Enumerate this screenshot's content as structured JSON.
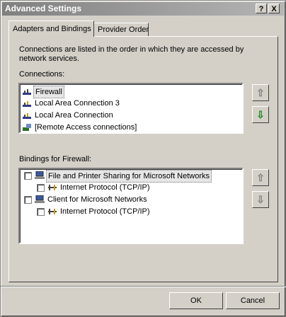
{
  "window": {
    "title": "Advanced Settings",
    "help_label": "?",
    "close_label": "X"
  },
  "tabs": [
    {
      "label": "Adapters and Bindings",
      "active": true
    },
    {
      "label": "Provider Order",
      "active": false
    }
  ],
  "description": "Connections are listed in the order in which they are accessed by network services.",
  "connections": {
    "label": "Connections:",
    "items": [
      {
        "label": "Firewall",
        "icon": "network-adapter-icon",
        "selected": true
      },
      {
        "label": "Local Area Connection 3",
        "icon": "network-adapter-icon"
      },
      {
        "label": "Local Area Connection",
        "icon": "network-adapter-icon"
      },
      {
        "label": "[Remote Access connections]",
        "icon": "remote-access-icon"
      }
    ]
  },
  "bindings": {
    "label": "Bindings for Firewall:",
    "items": [
      {
        "label": "File and Printer Sharing for Microsoft Networks",
        "level": 0,
        "checked": false,
        "selected": true,
        "icon": "computer-icon"
      },
      {
        "label": "Internet Protocol (TCP/IP)",
        "level": 1,
        "checked": false,
        "icon": "protocol-icon"
      },
      {
        "label": "Client for Microsoft Networks",
        "level": 0,
        "checked": false,
        "icon": "computer-icon"
      },
      {
        "label": "Internet Protocol (TCP/IP)",
        "level": 1,
        "checked": false,
        "icon": "protocol-icon"
      }
    ]
  },
  "arrow_glyphs": {
    "up": "⇧",
    "down": "⇩"
  },
  "buttons": {
    "ok": "OK",
    "cancel": "Cancel"
  },
  "colors": {
    "enabled_arrow": "#1a8a1a",
    "disabled_arrow": "#808080"
  }
}
